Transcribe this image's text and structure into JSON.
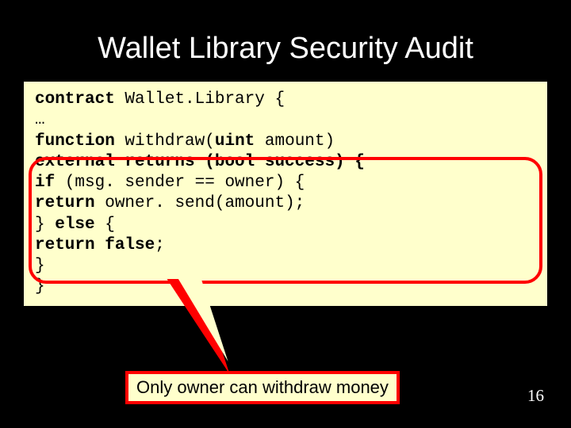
{
  "title": "Wallet Library Security Audit",
  "code": {
    "l1a": "contract",
    "l1b": " Wallet.Library {",
    "l2": " …",
    "l3a": "function",
    "l3b": " withdraw(",
    "l3c": "uint",
    "l3d": " amount)",
    "l4a": "  external returns (bool success) {",
    "l5a": " if",
    "l5b": " (msg. sender == owner) {",
    "l6a": "   return",
    "l6b": " owner. send(amount);",
    "l7a": " } ",
    "l7b": "else",
    "l7c": " {",
    "l8a": "   return false",
    "l8b": ";",
    "l9": " }",
    "l10": " }"
  },
  "callout": "Only owner can withdraw money",
  "page_number": "16"
}
